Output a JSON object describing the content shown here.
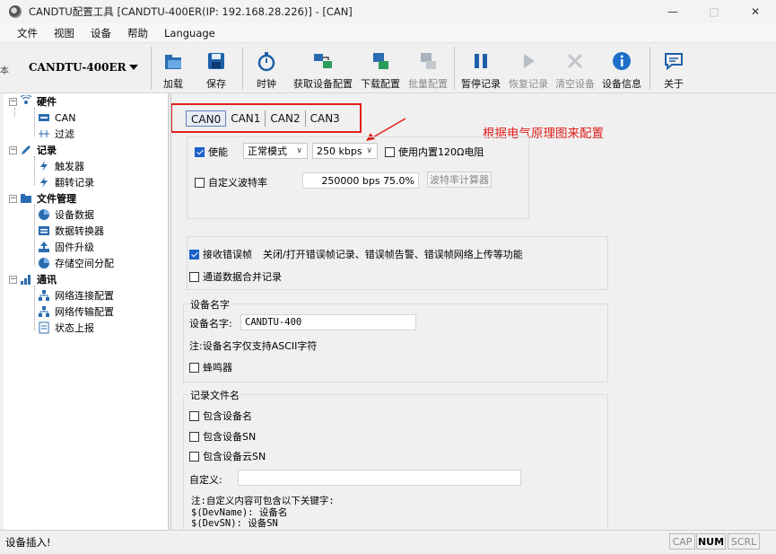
{
  "window": {
    "title": "CANDTU配置工具 [CANDTU-400ER(IP: 192.168.28.226)] - [CAN]",
    "minimize": "—",
    "maximize": "□",
    "close": "✕"
  },
  "menu": [
    "文件",
    "视图",
    "设备",
    "帮助",
    "Language"
  ],
  "toolbar": {
    "grip": "本",
    "device_selected": "CANDTU-400ER",
    "buttons": [
      {
        "label": "加载",
        "icon": "folder-open-icon",
        "enabled": true
      },
      {
        "label": "保存",
        "icon": "floppy-disk-icon",
        "enabled": true
      },
      {
        "label": "时钟",
        "icon": "stopwatch-icon",
        "enabled": true
      },
      {
        "label": "获取设备配置",
        "icon": "get-config-icon",
        "enabled": true
      },
      {
        "label": "下载配置",
        "icon": "download-config-icon",
        "enabled": true
      },
      {
        "label": "批量配置",
        "icon": "batch-config-icon",
        "enabled": false
      },
      {
        "label": "暂停记录",
        "icon": "pause-icon",
        "enabled": true
      },
      {
        "label": "恢复记录",
        "icon": "play-icon",
        "enabled": false
      },
      {
        "label": "清空设备",
        "icon": "clear-device-icon",
        "enabled": false
      },
      {
        "label": "设备信息",
        "icon": "info-icon",
        "enabled": true
      },
      {
        "label": "关于",
        "icon": "chat-bubble-icon",
        "enabled": true
      }
    ]
  },
  "tree": {
    "hardware": "硬件",
    "can": "CAN",
    "filter": "过滤",
    "record": "记录",
    "trigger": "触发器",
    "rollover": "翻转记录",
    "file_mgmt": "文件管理",
    "device_data": "设备数据",
    "data_converter": "数据转换器",
    "firmware": "固件升级",
    "storage": "存储空间分配",
    "comm": "通讯",
    "net_conn": "网络连接配置",
    "net_trans": "网络传输配置",
    "status_report": "状态上报"
  },
  "tabs": [
    "CAN0",
    "CAN1",
    "CAN2",
    "CAN3"
  ],
  "annotation": "根据电气原理图来配置",
  "can_settings": {
    "enable_label": "使能",
    "mode": "正常模式",
    "bitrate": "250 kbps",
    "termination_label": "使用内置120Ω电阻",
    "custom_baud_label": "自定义波特率",
    "custom_baud_value": "250000 bps 75.0%",
    "calc_button": "波特率计算器"
  },
  "error_frames": {
    "label": "接收错误帧",
    "description": "关闭/打开错误帧记录、错误帧告警、错误帧网络上传等功能",
    "merge_label": "通道数据合并记录"
  },
  "device_name": {
    "group": "设备名字",
    "label": "设备名字:",
    "value": "CANDTU-400",
    "note": "注:设备名字仅支持ASCII字符",
    "buzzer": "蜂鸣器"
  },
  "record_filename": {
    "group": "记录文件名",
    "include_name": "包含设备名",
    "include_sn": "包含设备SN",
    "include_cloud_sn": "包含设备云SN",
    "custom_label": "自定义:",
    "custom_value": "",
    "note_title": "注:自定义内容可包含以下关键字:",
    "kw1": "$(DevName): 设备名",
    "kw2": "$(DevSN): 设备SN"
  },
  "status": {
    "text": "设备插入!",
    "cap": "CAP",
    "num": "NUM",
    "scrl": "SCRL"
  },
  "colors": {
    "accent": "#1a61c8",
    "annotation_red": "#e0201c"
  }
}
